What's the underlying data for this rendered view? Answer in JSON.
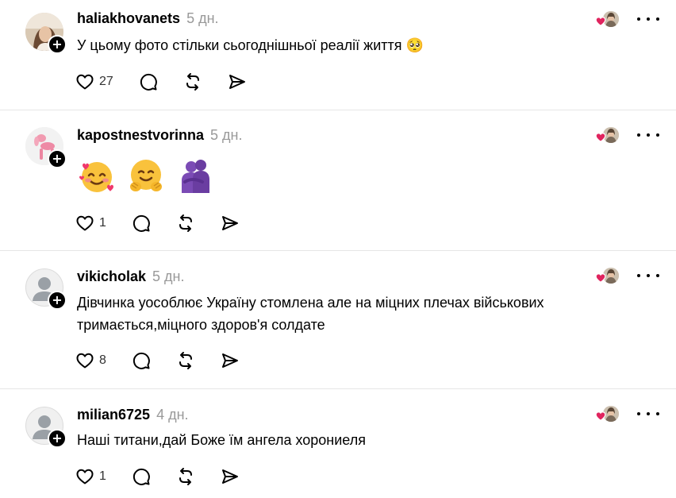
{
  "comments": [
    {
      "username": "haliakhovanets",
      "time": "5 дн.",
      "text": "У цьому фото стільки сьогоднішньої реалії життя",
      "text_emoji": "🥺",
      "likes": "27",
      "avatar_icon": "profile-photo-woman",
      "liked_by_author": true
    },
    {
      "username": "kapostnestvorinna",
      "time": "5 дн.",
      "text": "",
      "emojis": [
        "🥰",
        "🤗",
        "🫂"
      ],
      "likes": "1",
      "avatar_icon": "balloon-dog-photo",
      "liked_by_author": true
    },
    {
      "username": "vikicholak",
      "time": "5 дн.",
      "text": "Дівчинка уособлює Україну стомлена але на міцних плечах військових тримається,міцного здоров'я солдате",
      "likes": "8",
      "avatar_icon": "default-user-icon",
      "liked_by_author": true
    },
    {
      "username": "milian6725",
      "time": "4 дн.",
      "text": "Наші титани,дай Боже їм ангела хорониеля",
      "likes": "1",
      "avatar_icon": "default-user-icon",
      "liked_by_author": true
    }
  ],
  "colors": {
    "text": "#000000",
    "muted": "#999999",
    "heart": "#e0245e",
    "divider": "#e6e6e6"
  }
}
